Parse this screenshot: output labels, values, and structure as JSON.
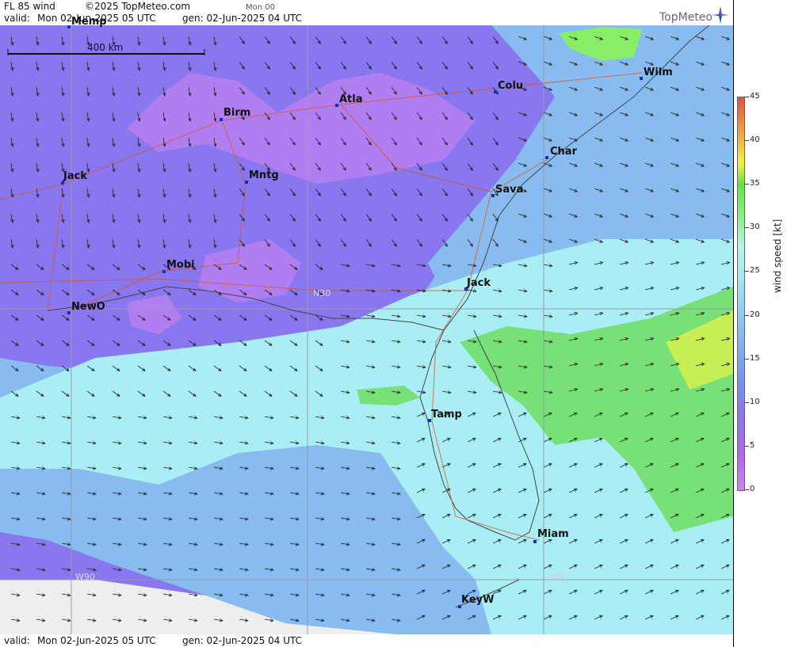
{
  "header": {
    "product": "FL 85 wind",
    "copyright": "©2025 TopMeteo.com",
    "run_label": "Mon 00",
    "valid_label": "valid:",
    "valid_value": "Mon  02-Jun-2025  05 UTC",
    "gen_label": "gen: 02-Jun-2025 04 UTC",
    "logo": "TopMeteo"
  },
  "scale": {
    "label": "400 km"
  },
  "grid_labels": {
    "lat": "N30",
    "lon_left": "W90",
    "lon_right": "W80"
  },
  "cities": [
    {
      "name": "Memp"
    },
    {
      "name": "Colu"
    },
    {
      "name": "Wilm"
    },
    {
      "name": "Atla"
    },
    {
      "name": "Birm"
    },
    {
      "name": "Char"
    },
    {
      "name": "Jack"
    },
    {
      "name": "Mntg"
    },
    {
      "name": "Sava"
    },
    {
      "name": "Mobi"
    },
    {
      "name": "Jack"
    },
    {
      "name": "NewO"
    },
    {
      "name": "Tamp"
    },
    {
      "name": "Miam"
    },
    {
      "name": "KeyW"
    }
  ],
  "legend": {
    "title": "wind speed [kt]",
    "ticks": [
      "45",
      "40",
      "35",
      "30",
      "25",
      "20",
      "15",
      "10",
      "5",
      "0"
    ],
    "colors": {
      "calm": "#cc88ee",
      "low": "#8877ee",
      "mid": "#88bbf0",
      "high": "#a8f0f4",
      "green": "#88ee66",
      "strong": "#e05040"
    }
  },
  "footer": {
    "valid_label": "valid:",
    "valid_value": "Mon  02-Jun-2025  05 UTC",
    "gen_label": "gen: 02-Jun-2025 04 UTC"
  }
}
